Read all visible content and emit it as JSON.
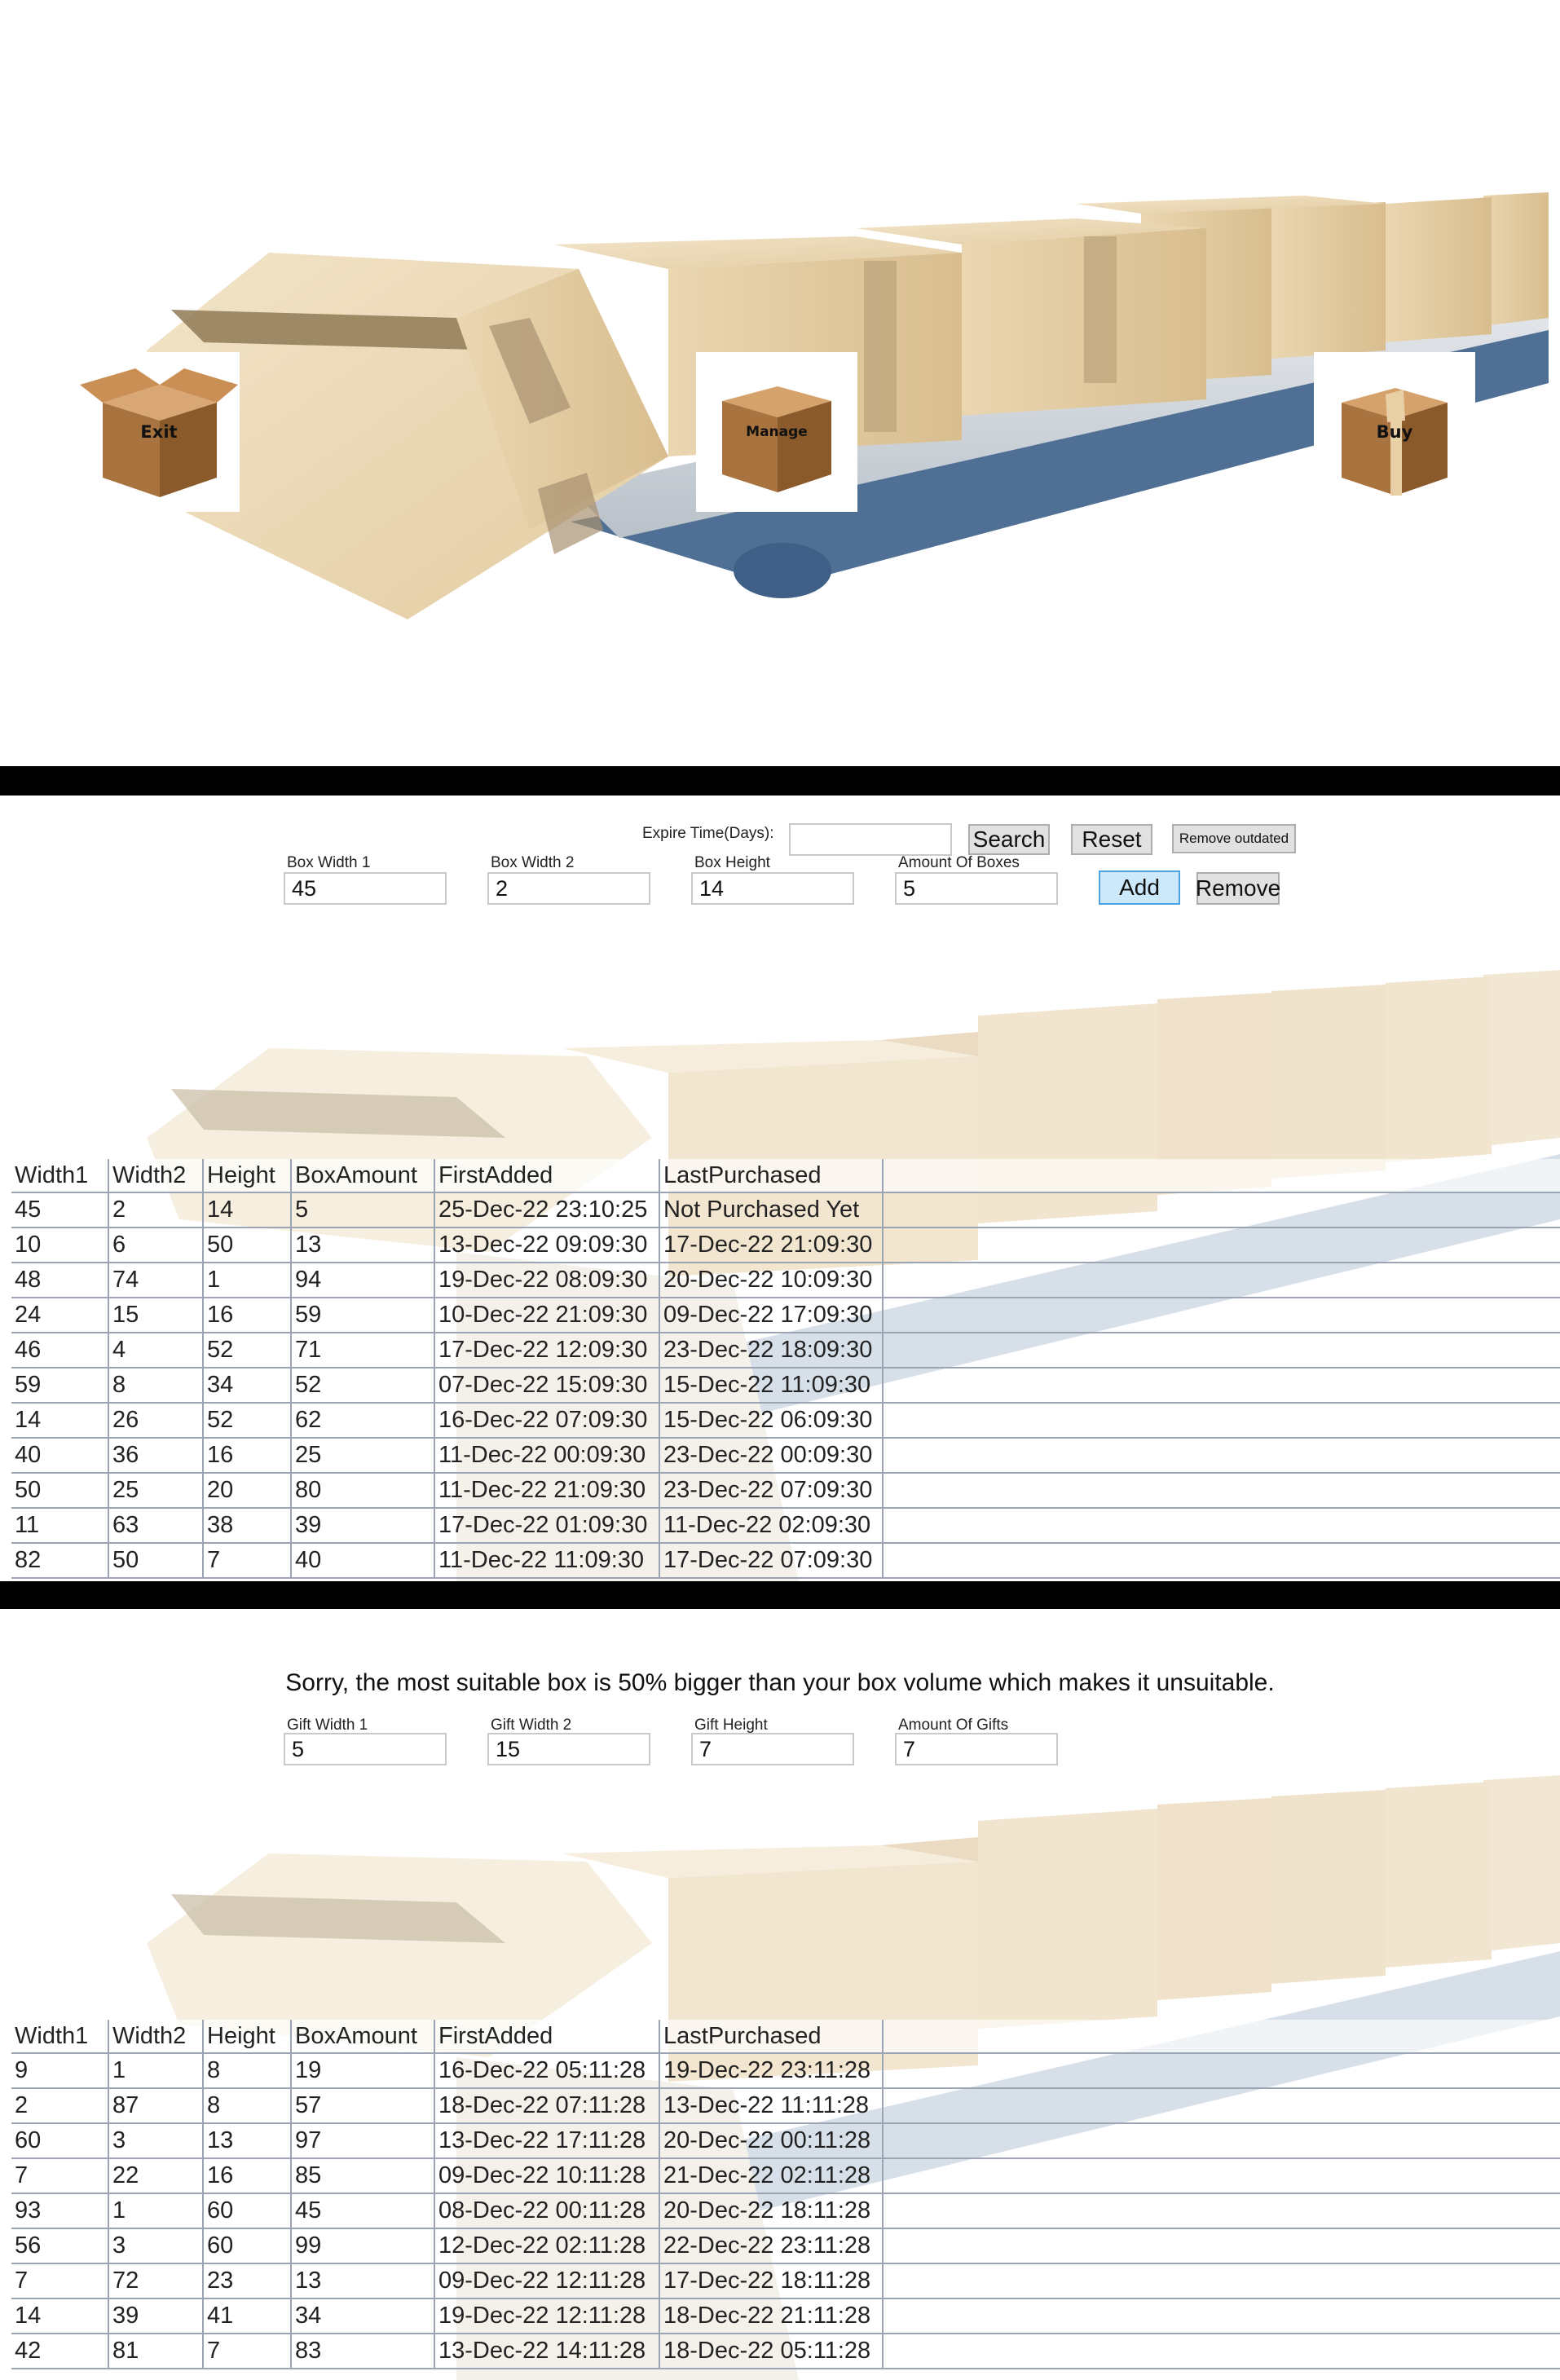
{
  "nav": {
    "exit_label": "Exit",
    "manage_label": "Manage",
    "buy_label": "Buy"
  },
  "manage": {
    "expire_label": "Expire Time(Days):",
    "expire_value": "",
    "search_label": "Search",
    "reset_label": "Reset",
    "remove_outdated_label": "Remove outdated",
    "fields": {
      "width1": {
        "label": "Box Width 1",
        "value": "45"
      },
      "width2": {
        "label": "Box Width 2",
        "value": "2"
      },
      "height": {
        "label": "Box Height",
        "value": "14"
      },
      "amount": {
        "label": "Amount Of Boxes",
        "value": "5"
      }
    },
    "add_label": "Add",
    "remove_label": "Remove",
    "table": {
      "columns": [
        "Width1",
        "Width2",
        "Height",
        "BoxAmount",
        "FirstAdded",
        "LastPurchased"
      ],
      "rows": [
        [
          "45",
          "2",
          "14",
          "5",
          "25-Dec-22 23:10:25",
          "Not Purchased Yet"
        ],
        [
          "10",
          "6",
          "50",
          "13",
          "13-Dec-22 09:09:30",
          "17-Dec-22 21:09:30"
        ],
        [
          "48",
          "74",
          "1",
          "94",
          "19-Dec-22 08:09:30",
          "20-Dec-22 10:09:30"
        ],
        [
          "24",
          "15",
          "16",
          "59",
          "10-Dec-22 21:09:30",
          "09-Dec-22 17:09:30"
        ],
        [
          "46",
          "4",
          "52",
          "71",
          "17-Dec-22 12:09:30",
          "23-Dec-22 18:09:30"
        ],
        [
          "59",
          "8",
          "34",
          "52",
          "07-Dec-22 15:09:30",
          "15-Dec-22 11:09:30"
        ],
        [
          "14",
          "26",
          "52",
          "62",
          "16-Dec-22 07:09:30",
          "15-Dec-22 06:09:30"
        ],
        [
          "40",
          "36",
          "16",
          "25",
          "11-Dec-22 00:09:30",
          "23-Dec-22 00:09:30"
        ],
        [
          "50",
          "25",
          "20",
          "80",
          "11-Dec-22 21:09:30",
          "23-Dec-22 07:09:30"
        ],
        [
          "11",
          "63",
          "38",
          "39",
          "17-Dec-22 01:09:30",
          "11-Dec-22 02:09:30"
        ],
        [
          "82",
          "50",
          "7",
          "40",
          "11-Dec-22 11:09:30",
          "17-Dec-22 07:09:30"
        ]
      ]
    }
  },
  "buy": {
    "message": "Sorry, the most suitable box is 50% bigger than your box volume which makes it unsuitable.",
    "fields": {
      "width1": {
        "label": "Gift Width 1",
        "value": "5"
      },
      "width2": {
        "label": "Gift Width 2",
        "value": "15"
      },
      "height": {
        "label": "Gift Height",
        "value": "7"
      },
      "amount": {
        "label": "Amount Of Gifts",
        "value": "7"
      }
    },
    "table": {
      "columns": [
        "Width1",
        "Width2",
        "Height",
        "BoxAmount",
        "FirstAdded",
        "LastPurchased"
      ],
      "rows": [
        [
          "9",
          "1",
          "8",
          "19",
          "16-Dec-22 05:11:28",
          "19-Dec-22 23:11:28"
        ],
        [
          "2",
          "87",
          "8",
          "57",
          "18-Dec-22 07:11:28",
          "13-Dec-22 11:11:28"
        ],
        [
          "60",
          "3",
          "13",
          "97",
          "13-Dec-22 17:11:28",
          "20-Dec-22 00:11:28"
        ],
        [
          "7",
          "22",
          "16",
          "85",
          "09-Dec-22 10:11:28",
          "21-Dec-22 02:11:28"
        ],
        [
          "93",
          "1",
          "60",
          "45",
          "08-Dec-22 00:11:28",
          "20-Dec-22 18:11:28"
        ],
        [
          "56",
          "3",
          "60",
          "99",
          "12-Dec-22 02:11:28",
          "22-Dec-22 23:11:28"
        ],
        [
          "7",
          "72",
          "23",
          "13",
          "09-Dec-22 12:11:28",
          "17-Dec-22 18:11:28"
        ],
        [
          "14",
          "39",
          "41",
          "34",
          "19-Dec-22 12:11:28",
          "18-Dec-22 21:11:28"
        ],
        [
          "42",
          "81",
          "7",
          "83",
          "13-Dec-22 14:11:28",
          "18-Dec-22 05:11:28"
        ]
      ]
    }
  }
}
